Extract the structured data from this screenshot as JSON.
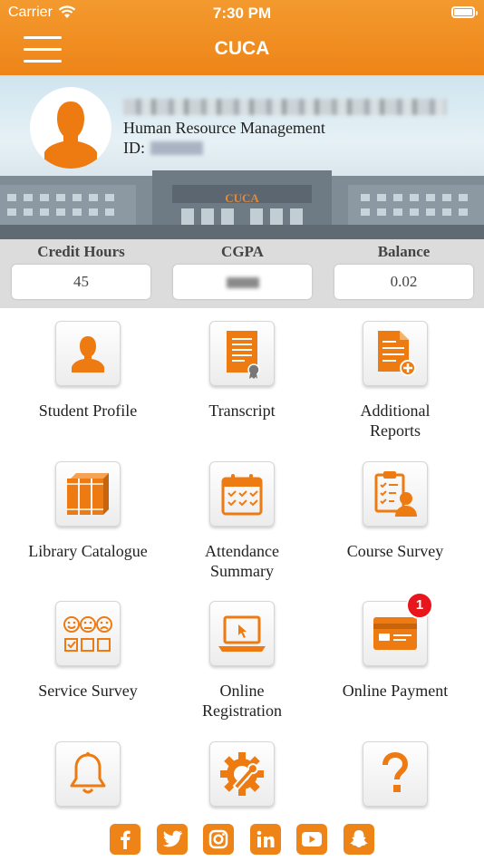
{
  "status_bar": {
    "carrier": "Carrier",
    "time": "7:30 PM"
  },
  "header": {
    "title": "CUCA"
  },
  "profile": {
    "department": "Human Resource Management",
    "id_label": "ID:",
    "building_sign": "CUCA"
  },
  "stats": {
    "credit_hours": {
      "label": "Credit Hours",
      "value": "45"
    },
    "cgpa": {
      "label": "CGPA",
      "value": ""
    },
    "balance": {
      "label": "Balance",
      "value": "0.02"
    }
  },
  "menu": {
    "student_profile": "Student Profile",
    "transcript": "Transcript",
    "additional_reports_1": "Additional",
    "additional_reports_2": "Reports",
    "library_catalogue": "Library Catalogue",
    "attendance_1": "Attendance",
    "attendance_2": "Summary",
    "course_survey": "Course Survey",
    "service_survey": "Service Survey",
    "online_registration_1": "Online",
    "online_registration_2": "Registration",
    "online_payment": "Online Payment",
    "online_payment_badge": "1"
  },
  "theme": {
    "accent": "#EE8418",
    "badge": "#E8151C"
  },
  "social_icons": [
    "facebook-icon",
    "twitter-icon",
    "instagram-icon",
    "linkedin-icon",
    "youtube-icon",
    "snapchat-icon"
  ]
}
